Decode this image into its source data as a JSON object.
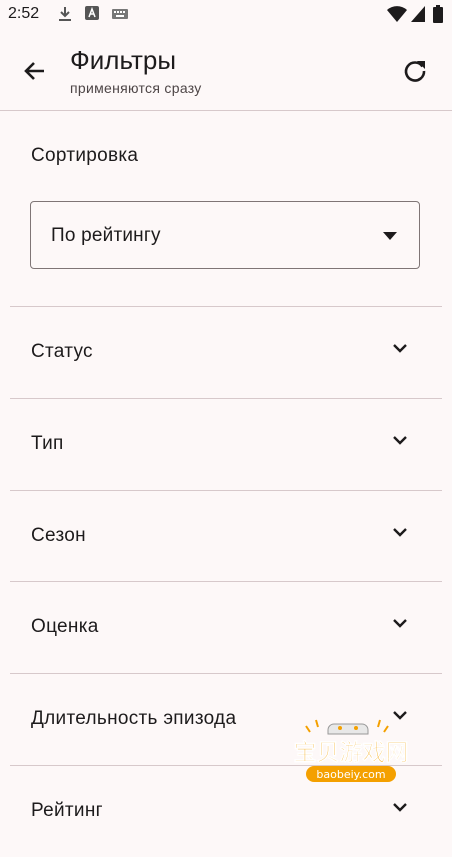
{
  "status_bar": {
    "time": "2:52"
  },
  "app_bar": {
    "title": "Фильтры",
    "subtitle": "применяются сразу"
  },
  "sort": {
    "label": "Сортировка",
    "selected": "По рейтингу"
  },
  "sections": [
    {
      "label": "Статус"
    },
    {
      "label": "Тип"
    },
    {
      "label": "Сезон"
    },
    {
      "label": "Оценка"
    },
    {
      "label": "Длительность эпизода"
    },
    {
      "label": "Рейтинг"
    }
  ],
  "watermark": {
    "title": "宝贝游戏网",
    "url": "baobeiy.com"
  },
  "colors": {
    "background": "#fdf8f8",
    "divider": "#d7c9cb",
    "text": "#1d1b1c",
    "outline": "#7f7576"
  }
}
